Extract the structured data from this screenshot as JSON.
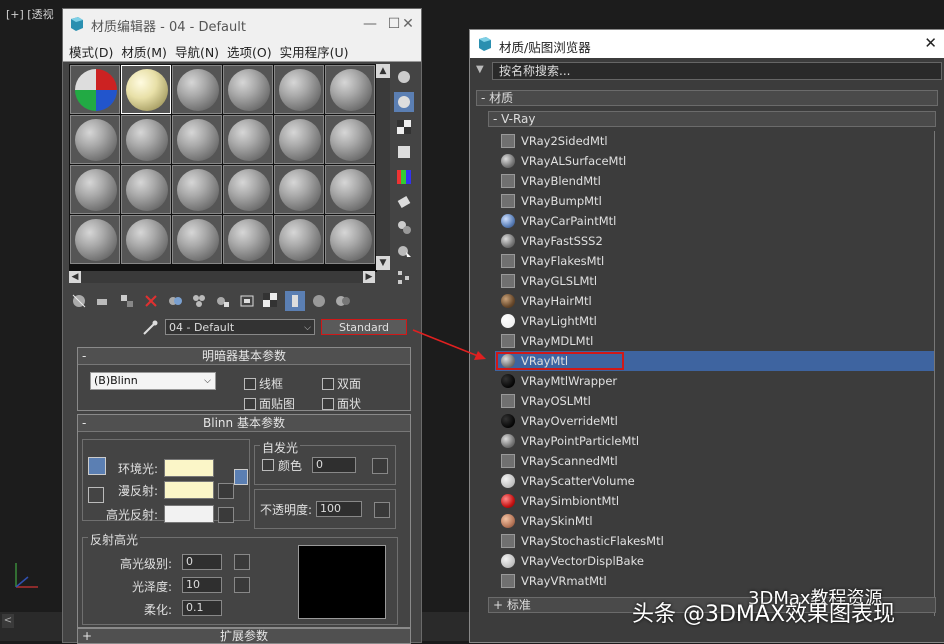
{
  "viewport": {
    "label": "[+] [透视",
    "bottom_arrow": "<"
  },
  "material_editor": {
    "title": "材质编辑器 - 04 - Default",
    "menu": [
      "模式(D)",
      "材质(M)",
      "导航(N)",
      "选项(O)",
      "实用程序(U)"
    ],
    "material_name": "04 - Default",
    "material_type": "Standard",
    "shader_rollout": {
      "title": "明暗器基本参数",
      "shader": "(B)Blinn",
      "checkboxes": [
        "线框",
        "双面",
        "面贴图",
        "面状"
      ]
    },
    "blinn_rollout": {
      "title": "Blinn 基本参数",
      "self_illum": "自发光",
      "color_label": "颜色",
      "color_value": "0",
      "ambient": "环境光:",
      "diffuse": "漫反射:",
      "specular": "高光反射:",
      "opacity_label": "不透明度:",
      "opacity_value": "100",
      "spec_highlights": "反射高光",
      "spec_level_label": "高光级别:",
      "spec_level": "0",
      "glossiness_label": "光泽度:",
      "glossiness": "10",
      "soften_label": "柔化:",
      "soften": "0.1"
    },
    "extended_rollout": "扩展参数"
  },
  "browser": {
    "title": "材质/贴图浏览器",
    "search_placeholder": "按名称搜索...",
    "cat_materials": "- 材质",
    "cat_vray": "- V-Ray",
    "cat_standard": "+ 标准",
    "items": [
      {
        "name": "VRay2SidedMtl",
        "icon": "flat"
      },
      {
        "name": "VRayALSurfaceMtl",
        "icon": "sphere-grey"
      },
      {
        "name": "VRayBlendMtl",
        "icon": "flat"
      },
      {
        "name": "VRayBumpMtl",
        "icon": "flat"
      },
      {
        "name": "VRayCarPaintMtl",
        "icon": "sphere-blue"
      },
      {
        "name": "VRayFastSSS2",
        "icon": "sphere-grey"
      },
      {
        "name": "VRayFlakesMtl",
        "icon": "flat"
      },
      {
        "name": "VRayGLSLMtl",
        "icon": "flat"
      },
      {
        "name": "VRayHairMtl",
        "icon": "sphere-brown"
      },
      {
        "name": "VRayLightMtl",
        "icon": "sphere-white"
      },
      {
        "name": "VRayMDLMtl",
        "icon": "flat"
      },
      {
        "name": "VRayMtl",
        "icon": "sphere-grey"
      },
      {
        "name": "VRayMtlWrapper",
        "icon": "sphere-black"
      },
      {
        "name": "VRayOSLMtl",
        "icon": "flat"
      },
      {
        "name": "VRayOverrideMtl",
        "icon": "sphere-black"
      },
      {
        "name": "VRayPointParticleMtl",
        "icon": "sphere-grey"
      },
      {
        "name": "VRayScannedMtl",
        "icon": "flat"
      },
      {
        "name": "VRayScatterVolume",
        "icon": "sphere-light"
      },
      {
        "name": "VRaySimbiontMtl",
        "icon": "sphere-red"
      },
      {
        "name": "VRaySkinMtl",
        "icon": "sphere-skin"
      },
      {
        "name": "VRayStochasticFlakesMtl",
        "icon": "flat"
      },
      {
        "name": "VRayVectorDisplBake",
        "icon": "sphere-light"
      },
      {
        "name": "VRayVRmatMtl",
        "icon": "flat"
      }
    ],
    "selected": "VRayMtl"
  },
  "watermark": {
    "main": "头条 @3DMAX效果图表现",
    "sub": "3DMax教程资源"
  }
}
